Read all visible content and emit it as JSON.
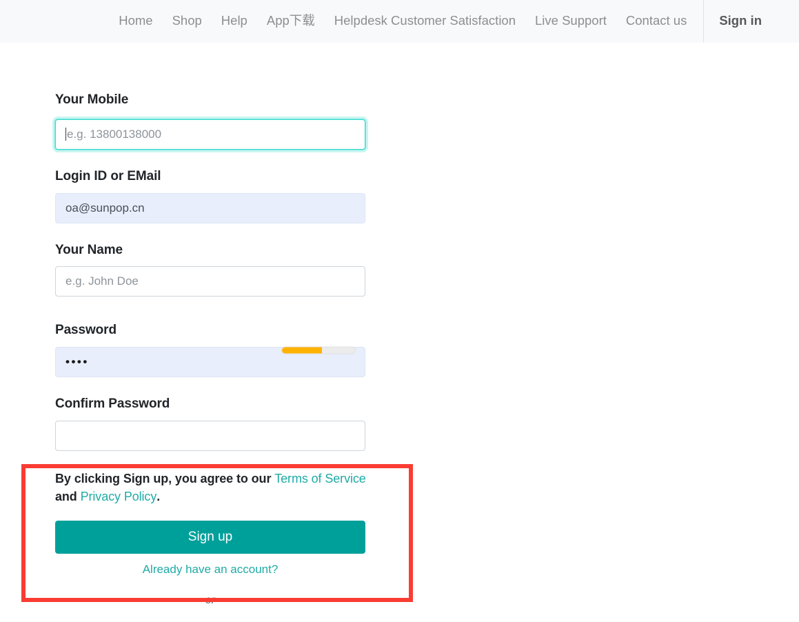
{
  "nav": {
    "items": [
      {
        "label": "Home",
        "name": "nav-item-home"
      },
      {
        "label": "Shop",
        "name": "nav-item-shop"
      },
      {
        "label": "Help",
        "name": "nav-item-help"
      },
      {
        "label": "App下载",
        "name": "nav-item-app-download"
      },
      {
        "label": "Helpdesk Customer Satisfaction",
        "name": "nav-item-helpdesk-customer-satisfaction"
      },
      {
        "label": "Live Support",
        "name": "nav-item-live-support"
      },
      {
        "label": "Contact us",
        "name": "nav-item-contact-us"
      }
    ],
    "signin_label": "Sign in"
  },
  "form": {
    "mobile": {
      "label": "Your Mobile",
      "placeholder": "e.g. 13800138000",
      "value": ""
    },
    "login": {
      "label": "Login ID or EMail",
      "placeholder": "",
      "value": "oa@sunpop.cn"
    },
    "name": {
      "label": "Your Name",
      "placeholder": "e.g. John Doe",
      "value": ""
    },
    "password": {
      "label": "Password",
      "placeholder": "",
      "value": "••••",
      "strength_percent": 55
    },
    "confirm_password": {
      "label": "Confirm Password",
      "placeholder": "",
      "value": ""
    }
  },
  "terms": {
    "lead": "By clicking Sign up, you agree to our ",
    "tos_label": "Terms of Service",
    "conjunction": " and ",
    "privacy_label": "Privacy Policy",
    "trailing": "."
  },
  "actions": {
    "signup_label": "Sign up",
    "already_account_label": "Already have an account?",
    "or_label": "- or -"
  },
  "colors": {
    "brand_teal": "#00a09a",
    "link_teal": "#1faba5",
    "focus_cyan": "#3ddbd0",
    "strength_orange": "#ffb300",
    "highlight_red": "#fa3c33",
    "autofill_blue": "#e8eefc",
    "navbar_bg": "#f8f9fa"
  }
}
